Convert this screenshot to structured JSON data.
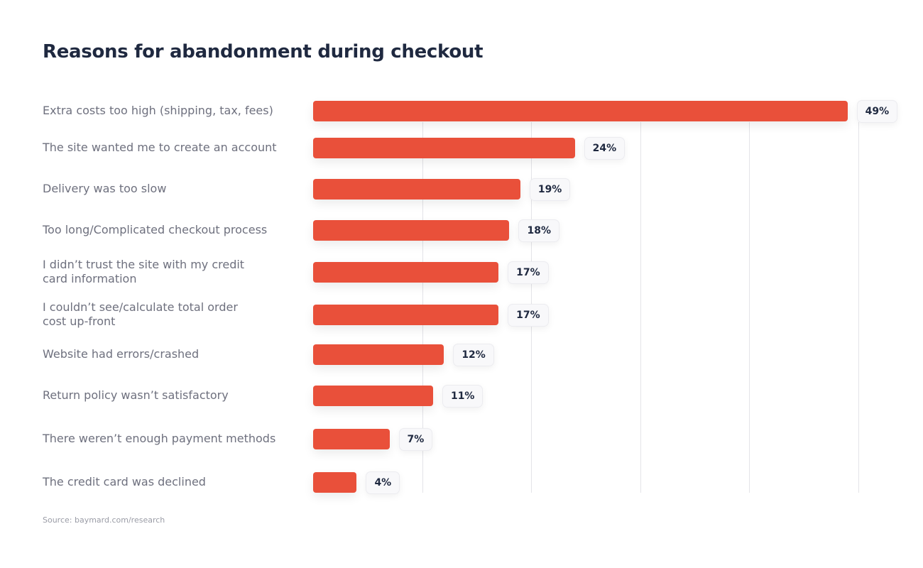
{
  "chart_data": {
    "type": "bar",
    "orientation": "horizontal",
    "title": "Reasons for abandonment during checkout",
    "xlabel": "",
    "ylabel": "",
    "xlim": [
      0,
      50
    ],
    "grid": true,
    "categories": [
      "Extra costs too high (shipping, tax, fees)",
      "The site wanted me to create an account",
      "Delivery was too slow",
      "Too long/Complicated checkout process",
      "I didn’t trust the site with my credit card information",
      "I couldn’t see/calculate total order cost up-front",
      "Website had errors/crashed",
      "Return policy wasn’t satisfactory",
      "There weren’t enough payment methods",
      "The credit card was declined"
    ],
    "label_lines": [
      [
        "Extra costs too high (shipping, tax, fees)"
      ],
      [
        "The site wanted me to create an account"
      ],
      [
        "Delivery was too slow"
      ],
      [
        "Too long/Complicated checkout process"
      ],
      [
        "I didn’t trust the site with my credit",
        "card information"
      ],
      [
        "I couldn’t see/calculate total order",
        "cost up-front"
      ],
      [
        "Website had errors/crashed"
      ],
      [
        "Return policy wasn’t satisfactory"
      ],
      [
        "There weren’t enough payment methods"
      ],
      [
        "The credit card was declined"
      ]
    ],
    "values": [
      49,
      24,
      19,
      18,
      17,
      17,
      12,
      11,
      7,
      4
    ],
    "value_labels": [
      "49%",
      "24%",
      "19%",
      "18%",
      "17%",
      "17%",
      "12%",
      "11%",
      "7%",
      "4%"
    ],
    "gridlines": [
      10,
      20,
      30,
      40,
      50
    ],
    "bar_color": "#e9503a",
    "source": "Source: baymard.com/research"
  }
}
